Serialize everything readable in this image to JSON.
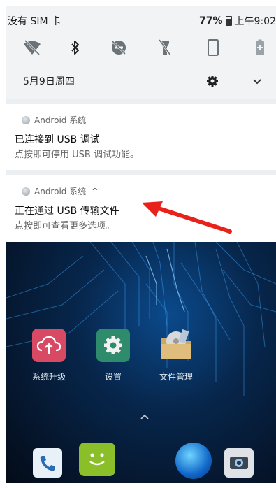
{
  "status_bar": {
    "carrier": "没有 SIM 卡",
    "battery": "77%",
    "time": "上午9:02"
  },
  "quick_settings": {
    "tiles": [
      "wifi-off-icon",
      "bluetooth-icon",
      "do-not-disturb-off-icon",
      "flashlight-off-icon",
      "rotation-lock-icon",
      "battery-saver-icon"
    ],
    "date": "5月9日周四"
  },
  "notifications": [
    {
      "app": "Android 系统",
      "title": "已连接到 USB 调试",
      "body": "点按即可停用 USB 调试功能。"
    },
    {
      "app": "Android 系统",
      "caret": "^",
      "title": "正在通过 USB 传输文件",
      "body": "点按即可查看更多选项。"
    }
  ],
  "home": {
    "apps": [
      {
        "label": "系统升级",
        "icon": "system-upgrade-icon"
      },
      {
        "label": "设置",
        "icon": "settings-icon"
      },
      {
        "label": "文件管理",
        "icon": "file-manager-icon"
      }
    ],
    "drawer_caret": "^",
    "dock": [
      "phone-icon",
      "messages-icon",
      "browser-icon",
      "camera-icon"
    ]
  },
  "colors": {
    "annotation_arrow": "#e8211a",
    "upgrade_icon": "#d84a63",
    "settings_icon": "#2e8b6c"
  }
}
